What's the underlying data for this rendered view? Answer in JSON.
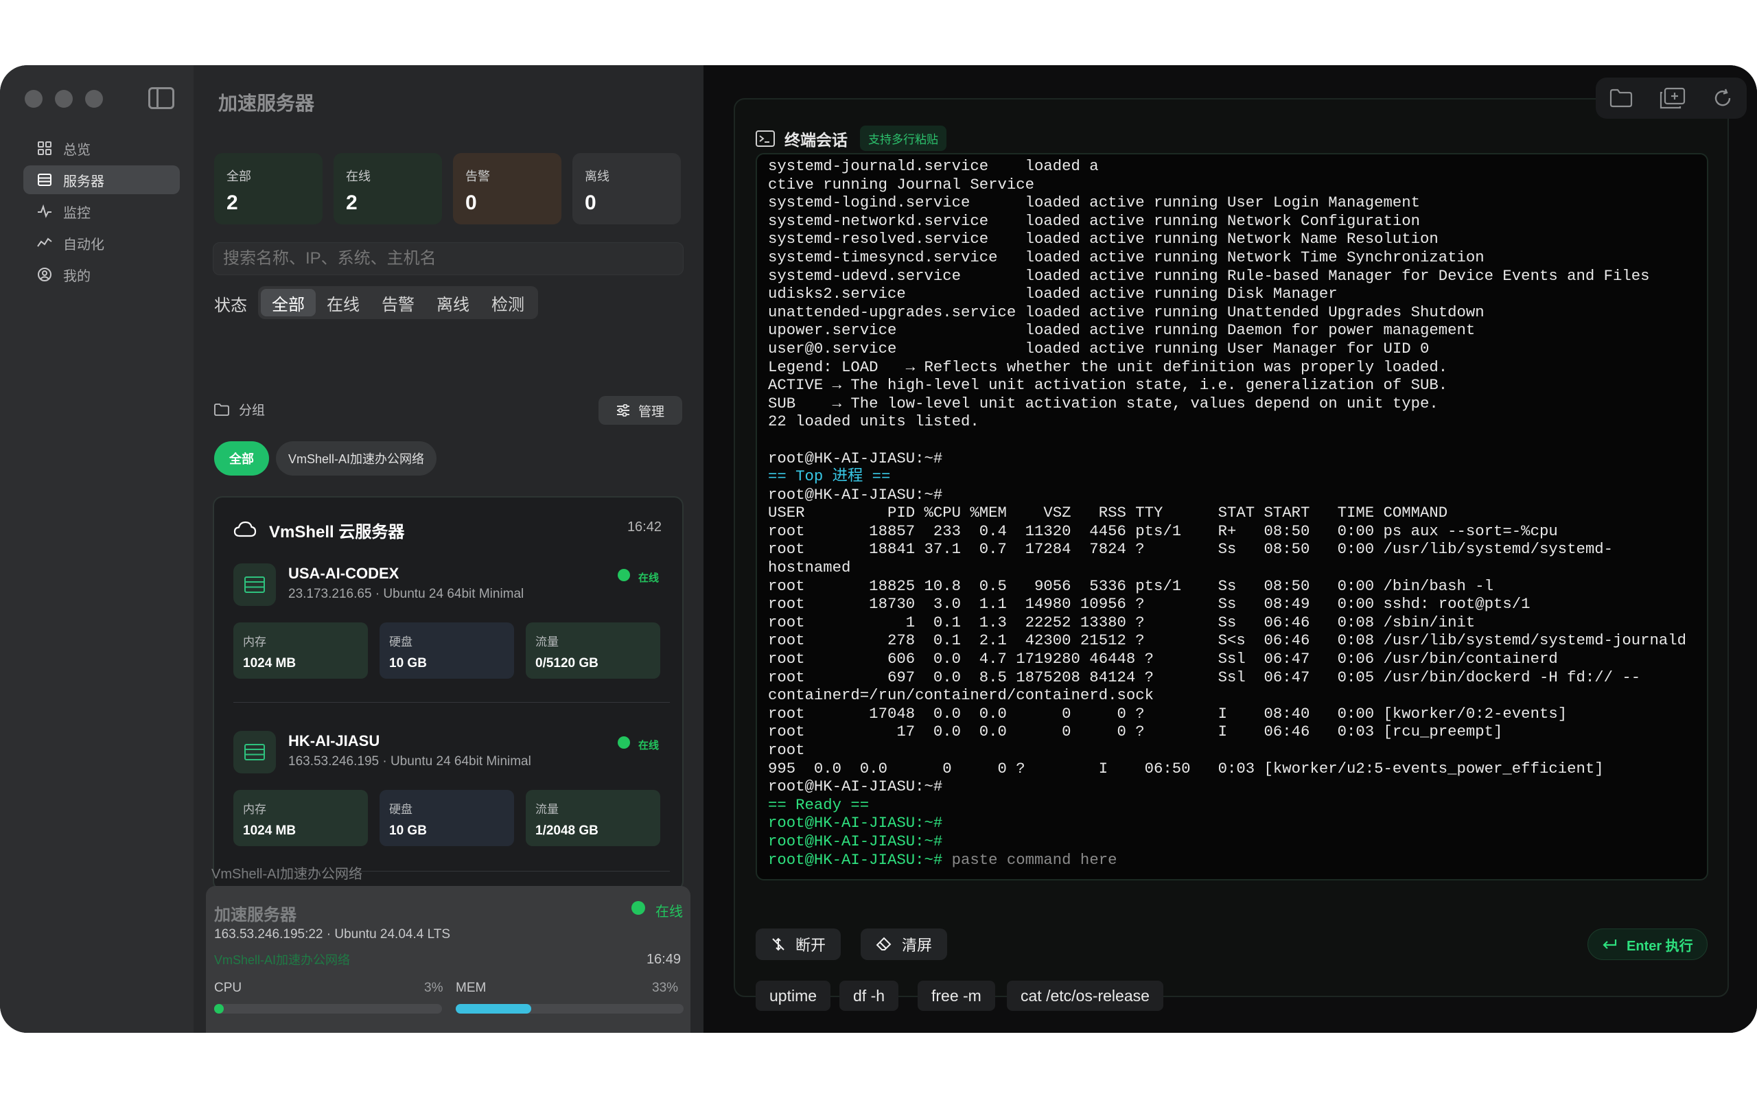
{
  "sidebar": {
    "items": [
      {
        "label": "总览",
        "icon": "grid-icon"
      },
      {
        "label": "服务器",
        "icon": "server-icon"
      },
      {
        "label": "监控",
        "icon": "pulse-icon"
      },
      {
        "label": "自动化",
        "icon": "automation-icon"
      },
      {
        "label": "我的",
        "icon": "user-circle-icon"
      }
    ],
    "active_index": 1
  },
  "list": {
    "title": "加速服务器",
    "stats": [
      {
        "label": "全部",
        "value": "2"
      },
      {
        "label": "在线",
        "value": "2"
      },
      {
        "label": "告警",
        "value": "0"
      },
      {
        "label": "离线",
        "value": "0"
      }
    ],
    "search_placeholder": "搜索名称、IP、系统、主机名",
    "status_label": "状态",
    "filters": [
      "全部",
      "在线",
      "告警",
      "离线",
      "检测"
    ],
    "active_filter": 0,
    "group_label": "分组",
    "manage_label": "管理",
    "group_chips": [
      "全部",
      "VmShell-AI加速办公网络"
    ],
    "cloud_card": {
      "title": "VmShell 云服务器",
      "time": "16:42",
      "servers": [
        {
          "name": "USA-AI-CODEX",
          "meta": "23.173.216.65 · Ubuntu 24 64bit Minimal",
          "status": "在线",
          "metrics": [
            {
              "label": "内存",
              "value": "1024 MB"
            },
            {
              "label": "硬盘",
              "value": "10 GB"
            },
            {
              "label": "流量",
              "value": "0/5120 GB"
            }
          ]
        },
        {
          "name": "HK-AI-JIASU",
          "meta": "163.53.246.195 · Ubuntu 24 64bit Minimal",
          "status": "在线",
          "metrics": [
            {
              "label": "内存",
              "value": "1024 MB"
            },
            {
              "label": "硬盘",
              "value": "10 GB"
            },
            {
              "label": "流量",
              "value": "1/2048 GB"
            }
          ]
        }
      ]
    },
    "section_label": "VmShell-AI加速办公网络",
    "bottom_card": {
      "title": "加速服务器",
      "status": "在线",
      "meta": "163.53.246.195:22 · Ubuntu 24.04.4 LTS",
      "group": "VmShell-AI加速办公网络",
      "time": "16:49",
      "cpu_label": "CPU",
      "cpu_value": "3%",
      "cpu_fraction": 0.03,
      "mem_label": "MEM",
      "mem_value": "33%",
      "mem_fraction": 0.33
    }
  },
  "terminal": {
    "title": "终端会话",
    "badge": "支持多行粘贴",
    "window_controls": [
      "folder-icon",
      "new-window-icon",
      "refresh-icon"
    ],
    "lines": [
      {
        "t": "systemd-journald.service    loaded a"
      },
      {
        "t": "ctive running Journal Service"
      },
      {
        "t": "systemd-logind.service      loaded active running User Login Management"
      },
      {
        "t": "systemd-networkd.service    loaded active running Network Configuration"
      },
      {
        "t": "systemd-resolved.service    loaded active running Network Name Resolution"
      },
      {
        "t": "systemd-timesyncd.service   loaded active running Network Time Synchronization"
      },
      {
        "t": "systemd-udevd.service       loaded active running Rule-based Manager for Device Events and Files"
      },
      {
        "t": "udisks2.service             loaded active running Disk Manager"
      },
      {
        "t": "unattended-upgrades.service loaded active running Unattended Upgrades Shutdown"
      },
      {
        "t": "upower.service              loaded active running Daemon for power management"
      },
      {
        "t": "user@0.service              loaded active running User Manager for UID 0"
      },
      {
        "t": "Legend: LOAD   → Reflects whether the unit definition was properly loaded."
      },
      {
        "t": "ACTIVE → The high-level unit activation state, i.e. generalization of SUB."
      },
      {
        "t": "SUB    → The low-level unit activation state, values depend on unit type."
      },
      {
        "t": "22 loaded units listed."
      },
      {
        "t": ""
      },
      {
        "t": "root@HK-AI-JIASU:~#"
      },
      {
        "t": "== Top 进程 ==",
        "c": "t-c"
      },
      {
        "t": "root@HK-AI-JIASU:~#"
      },
      {
        "t": "USER         PID %CPU %MEM    VSZ   RSS TTY      STAT START   TIME COMMAND"
      },
      {
        "t": "root       18857  233  0.4  11320  4456 pts/1    R+   08:50   0:00 ps aux --sort=-%cpu"
      },
      {
        "t": "root       18841 37.1  0.7  17284  7824 ?        Ss   08:50   0:00 /usr/lib/systemd/systemd-"
      },
      {
        "t": "hostnamed"
      },
      {
        "t": "root       18825 10.8  0.5   9056  5336 pts/1    Ss   08:50   0:00 /bin/bash -l"
      },
      {
        "t": "root       18730  3.0  1.1  14980 10956 ?        Ss   08:49   0:00 sshd: root@pts/1"
      },
      {
        "t": "root           1  0.1  1.3  22252 13380 ?        Ss   06:46   0:08 /sbin/init"
      },
      {
        "t": "root         278  0.1  2.1  42300 21512 ?        S<s  06:46   0:08 /usr/lib/systemd/systemd-journald"
      },
      {
        "t": "root         606  0.0  4.7 1719280 46448 ?       Ssl  06:47   0:06 /usr/bin/containerd"
      },
      {
        "t": "root         697  0.0  8.5 1875208 84124 ?       Ssl  06:47   0:05 /usr/bin/dockerd -H fd:// --"
      },
      {
        "t": "containerd=/run/containerd/containerd.sock"
      },
      {
        "t": "root       17048  0.0  0.0      0     0 ?        I    08:40   0:00 [kworker/0:2-events]"
      },
      {
        "t": "root          17  0.0  0.0      0     0 ?        I    06:46   0:03 [rcu_preempt]"
      },
      {
        "t": "root"
      },
      {
        "t": "995  0.0  0.0      0     0 ?        I    06:50   0:03 [kworker/u2:5-events_power_efficient]"
      },
      {
        "t": "root@HK-AI-JIASU:~#"
      },
      {
        "t": "== Ready ==",
        "c": "t-g"
      },
      {
        "t": "root@HK-AI-JIASU:~#",
        "c": "t-g"
      },
      {
        "t": "root@HK-AI-JIASU:~#",
        "c": "t-g"
      }
    ],
    "prompt": "root@HK-AI-JIASU:~#",
    "input_placeholder": "paste command here",
    "disconnect_label": "断开",
    "clear_label": "清屏",
    "enter_label": "Enter 执行",
    "quick_commands": [
      "uptime",
      "df -h",
      "free -m",
      "cat /etc/os-release"
    ]
  },
  "colors": {
    "accent_green": "#22c55e",
    "mem_bar": "#3bbfe0",
    "warn_card": "#3b3028",
    "online_card": "#233028"
  }
}
